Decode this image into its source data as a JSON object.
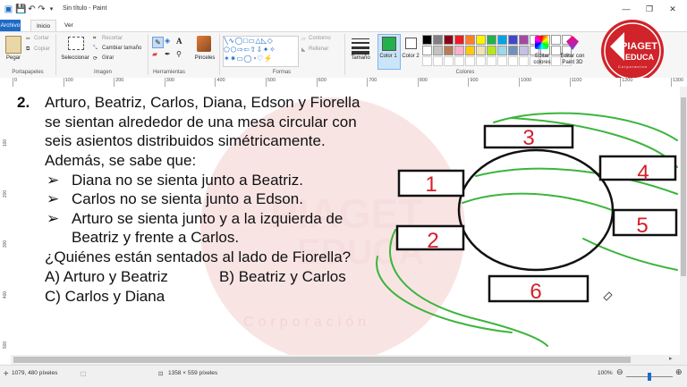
{
  "window": {
    "title": "Sin título - Paint",
    "quick_icons": [
      "💾",
      "↶",
      "↷",
      "▾"
    ]
  },
  "menu": {
    "file": "Archivo",
    "home": "Inicio",
    "view": "Ver"
  },
  "ribbon": {
    "clipboard": {
      "paste": "Pegar",
      "cut": "Cortar",
      "copy": "Copiar",
      "label": "Portapapeles"
    },
    "image": {
      "select": "Seleccionar",
      "crop": "Recortar",
      "resize": "Cambiar tamaño",
      "rotate": "Girar",
      "label": "Imagen"
    },
    "tools": {
      "label": "Herramientas",
      "brushes": "Pinceles"
    },
    "shapes": {
      "outline": "Contorno",
      "fill": "Rellenar",
      "label": "Formas"
    },
    "size": {
      "label": "Tamaño"
    },
    "colors": {
      "color1": "Color 1",
      "color2": "Color 2",
      "edit": "Editar colores",
      "paint3d": "Editar con Paint 3D",
      "label": "Colores"
    },
    "palette_row1": [
      "#000000",
      "#7f7f7f",
      "#880015",
      "#ed1c24",
      "#ff7f27",
      "#fff200",
      "#22b14c",
      "#00a2e8",
      "#3f48cc",
      "#a349a4"
    ],
    "palette_row2": [
      "#ffffff",
      "#c3c3c3",
      "#b97a57",
      "#ffaec9",
      "#ffc90e",
      "#efe4b0",
      "#b5e61d",
      "#99d9ea",
      "#7092be",
      "#c8bfe7"
    ]
  },
  "ruler": {
    "h_ticks": [
      "0",
      "100",
      "200",
      "300",
      "400",
      "500",
      "600",
      "700",
      "800",
      "900",
      "1000",
      "1100",
      "1200",
      "1300"
    ],
    "v_ticks": [
      "100",
      "200",
      "300",
      "400",
      "500"
    ]
  },
  "logo": {
    "line1": "PIAGET",
    "line2": "EDUCA",
    "line3": "Corporación"
  },
  "watermark": {
    "text1": "PIAGET",
    "text2": "EDUCA",
    "text3": "Corporación"
  },
  "problem": {
    "number": "2.",
    "lines": [
      "Arturo, Beatriz, Carlos, Diana, Edson y Fiorella",
      "se sientan alrededor de una mesa circular con",
      "seis asientos distribuidos simétricamente.",
      "Además, se sabe que:"
    ],
    "bullets": [
      "Diana no se sienta junto a Beatriz.",
      "Carlos no se sienta junto a Edson.",
      "Arturo se sienta junto y a la izquierda de",
      "Beatriz y frente a Carlos."
    ],
    "question": "¿Quiénes están sentados al lado de Fiorella?",
    "options": {
      "a": "A) Arturo y Beatriz",
      "b": "B) Beatriz y Carlos",
      "c": "C) Carlos y Diana"
    }
  },
  "seats": {
    "s1": "1",
    "s2": "2",
    "s3": "3",
    "s4": "4",
    "s5": "5",
    "s6": "6"
  },
  "status": {
    "cursor_pos": "1079, 480 píxeles",
    "canvas_size": "1358 × 559 píxeles",
    "zoom": "100%"
  }
}
